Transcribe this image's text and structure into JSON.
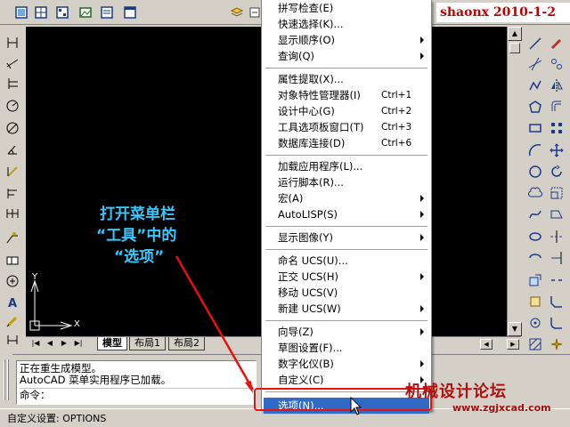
{
  "brand": {
    "text": "shaonx 2010-1-2"
  },
  "tools_menu": {
    "groups": [
      [
        {
          "label": "拼写检查(E)",
          "shortcut": "",
          "submenu": false
        },
        {
          "label": "快速选择(K)...",
          "shortcut": "",
          "submenu": false
        },
        {
          "label": "显示顺序(O)",
          "shortcut": "",
          "submenu": true
        },
        {
          "label": "查询(Q)",
          "shortcut": "",
          "submenu": true
        }
      ],
      [
        {
          "label": "属性提取(X)...",
          "shortcut": "",
          "submenu": false
        },
        {
          "label": "对象特性管理器(I)",
          "shortcut": "Ctrl+1",
          "submenu": false
        },
        {
          "label": "设计中心(G)",
          "shortcut": "Ctrl+2",
          "submenu": false
        },
        {
          "label": "工具选项板窗口(T)",
          "shortcut": "Ctrl+3",
          "submenu": false
        },
        {
          "label": "数据库连接(D)",
          "shortcut": "Ctrl+6",
          "submenu": false
        }
      ],
      [
        {
          "label": "加载应用程序(L)...",
          "shortcut": "",
          "submenu": false
        },
        {
          "label": "运行脚本(R)...",
          "shortcut": "",
          "submenu": false
        },
        {
          "label": "宏(A)",
          "shortcut": "",
          "submenu": true
        },
        {
          "label": "AutoLISP(S)",
          "shortcut": "",
          "submenu": true
        }
      ],
      [
        {
          "label": "显示图像(Y)",
          "shortcut": "",
          "submenu": true
        }
      ],
      [
        {
          "label": "命名 UCS(U)...",
          "shortcut": "",
          "submenu": false
        },
        {
          "label": "正交 UCS(H)",
          "shortcut": "",
          "submenu": true
        },
        {
          "label": "移动 UCS(V)",
          "shortcut": "",
          "submenu": false
        },
        {
          "label": "新建 UCS(W)",
          "shortcut": "",
          "submenu": true
        }
      ],
      [
        {
          "label": "向导(Z)",
          "shortcut": "",
          "submenu": true
        },
        {
          "label": "草图设置(F)...",
          "shortcut": "",
          "submenu": false
        },
        {
          "label": "数字化仪(B)",
          "shortcut": "",
          "submenu": true
        },
        {
          "label": "自定义(C)",
          "shortcut": "",
          "submenu": true
        }
      ],
      [
        {
          "label": "选项(N)...",
          "shortcut": "",
          "submenu": false,
          "highlighted": true
        }
      ]
    ]
  },
  "annotation": {
    "line1": "打开菜单栏",
    "line2": "“工具”中的",
    "line3": "“选项”"
  },
  "layout_tabs": {
    "model": "模型",
    "layout1": "布局1",
    "layout2": "布局2"
  },
  "ucs_axes": {
    "x": "X",
    "y": "Y"
  },
  "command_area": {
    "history": [
      "正在重生成模型。",
      "AutoCAD 菜单实用程序已加载。"
    ],
    "prompt": "命令："
  },
  "status_bar": {
    "text": "自定义设置:  OPTIONS"
  },
  "watermark": {
    "title": "机械设计论坛",
    "url": "www.zgjxcad.com"
  },
  "colors": {
    "annotation": "#35c8ff",
    "highlight": "#316ac5",
    "callout_red": "#e81010",
    "brand_red": "#c00000"
  }
}
